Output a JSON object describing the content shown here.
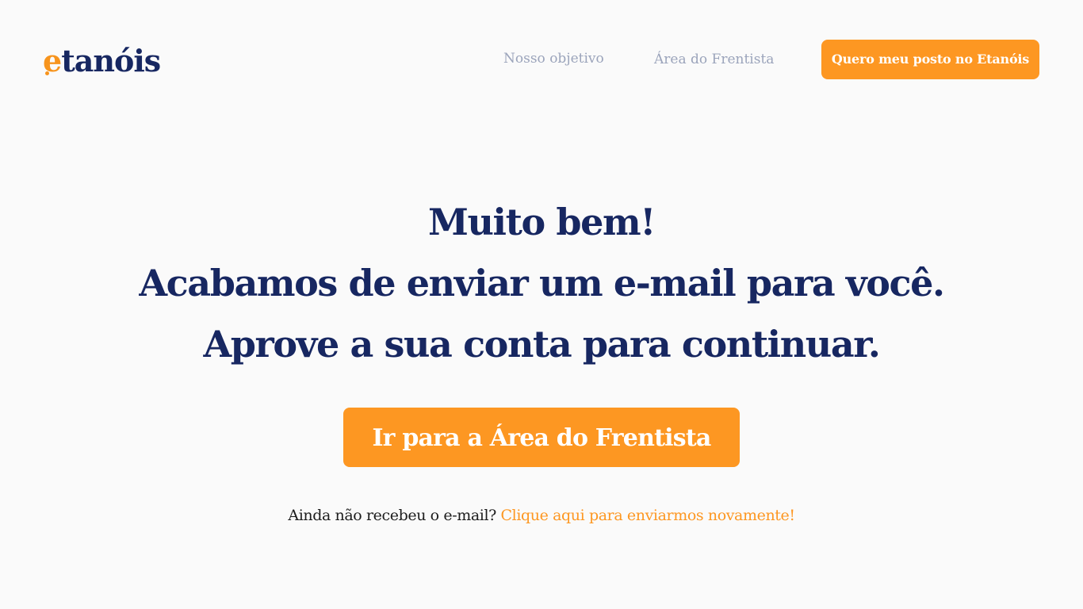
{
  "header": {
    "logo": {
      "prefix": "e",
      "rest": "tanóis"
    },
    "nav": {
      "objetivo": "Nosso objetivo",
      "frentista": "Área do Frentista"
    },
    "cta_label": "Quero meu posto no Etanóis"
  },
  "hero": {
    "line1": "Muito bem!",
    "line2": "Acabamos de enviar um e-mail para você.",
    "line3": "Aprove a sua conta para continuar."
  },
  "main_cta_label": "Ir para a Área do Frentista",
  "resend": {
    "text": "Ainda não recebeu o e-mail?",
    "link": "Clique aqui para enviarmos novamente!"
  },
  "colors": {
    "brand_orange": "#fd9722",
    "brand_navy": "#172761",
    "nav_gray": "#9ba4bb",
    "background": "#fafafa"
  }
}
